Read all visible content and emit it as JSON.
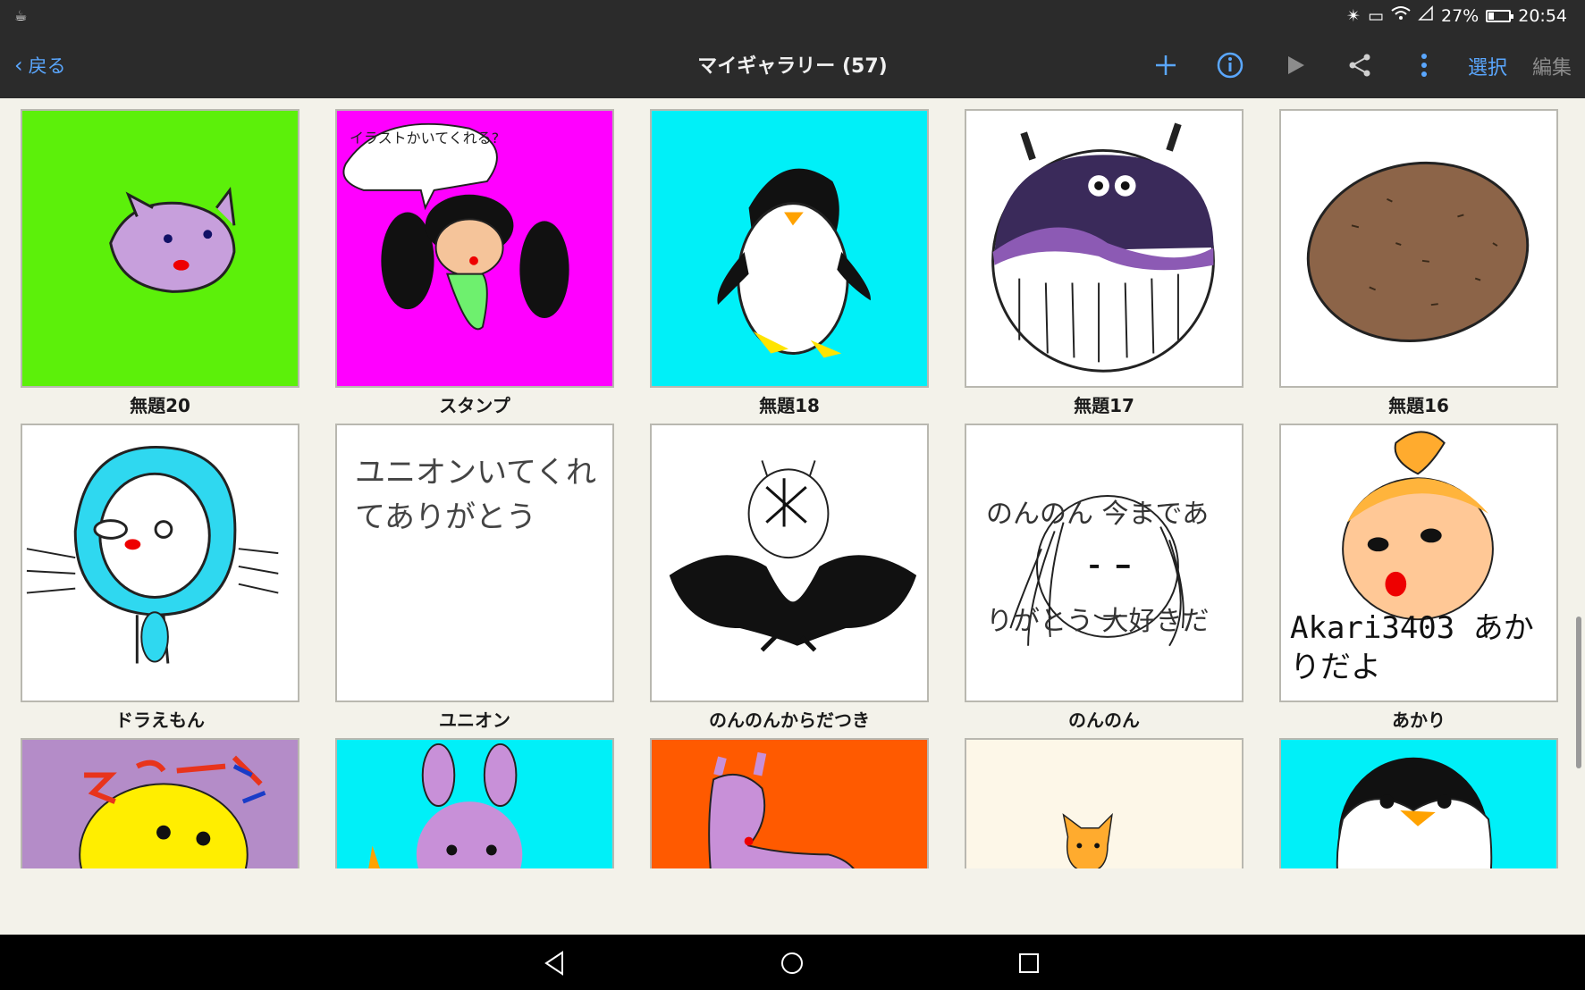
{
  "status": {
    "time": "20:54",
    "battery_text": "27%",
    "battery_level": 0.27,
    "icons": [
      "coffee-icon",
      "bluetooth-icon",
      "vibrate-icon",
      "wifi-icon",
      "signal-icon",
      "battery-icon"
    ]
  },
  "toolbar": {
    "back_label": "戻る",
    "title": "マイギャラリー (57)",
    "select_label": "選択",
    "edit_label": "編集",
    "accent": "#5aa7ff"
  },
  "tiles": [
    {
      "caption": "無題20",
      "bg": "#5cf00a"
    },
    {
      "caption": "スタンプ",
      "bg": "#ff00ff",
      "drawn_text": "イラストかいてくれる?"
    },
    {
      "caption": "無題18",
      "bg": "#00f0f8"
    },
    {
      "caption": "無題17",
      "bg": "#ffffff"
    },
    {
      "caption": "無題16",
      "bg": "#ffffff"
    },
    {
      "caption": "ドラえもん",
      "bg": "#ffffff"
    },
    {
      "caption": "ユニオン",
      "bg": "#ffffff",
      "drawn_text": "ユニオンいてくれてありがとう"
    },
    {
      "caption": "のんのんからだつき",
      "bg": "#ffffff"
    },
    {
      "caption": "のんのん",
      "bg": "#ffffff",
      "drawn_text": "のんのん 今までありがとう 大好きだよ"
    },
    {
      "caption": "あかり",
      "bg": "#ffffff",
      "drawn_text": "Akari3403 あかりだよ"
    },
    {
      "caption": "",
      "bg": "#b48cc8"
    },
    {
      "caption": "",
      "bg": "#00f0f8"
    },
    {
      "caption": "",
      "bg": "#ff5a00"
    },
    {
      "caption": "",
      "bg": "#fdf7e8"
    },
    {
      "caption": "",
      "bg": "#00f0f8"
    }
  ]
}
